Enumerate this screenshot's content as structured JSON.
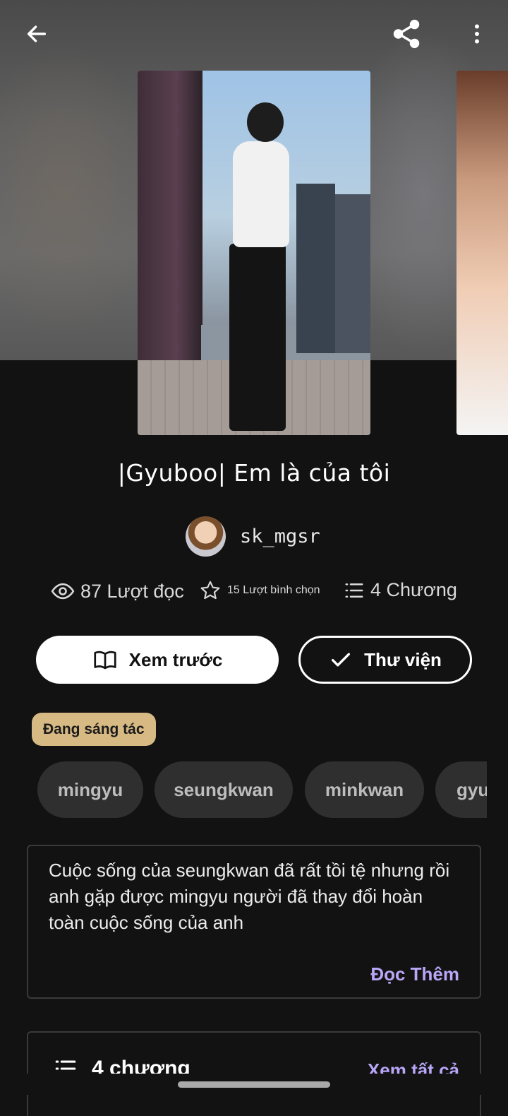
{
  "story": {
    "title": "|Gyuboo| Em là của tôi",
    "author": "sk_mgsr",
    "stats": {
      "reads": "87 Lượt đọc",
      "votes": "15 Lượt bình chọn",
      "parts": "4 Chương"
    },
    "status": "Đang sáng tác",
    "tags": [
      "mingyu",
      "seungkwan",
      "minkwan",
      "gyu"
    ],
    "description": "Cuộc sống của seungkwan đã rất tồi tệ nhưng rồi anh gặp được mingyu người đã thay đổi hoàn toàn cuộc sống của anh",
    "read_more": "Đọc Thêm"
  },
  "actions": {
    "preview_label": "Xem trước",
    "library_label": "Thư viện"
  },
  "parts_section": {
    "title": "4 chương",
    "see_all": "Xem tất cả"
  },
  "icons": {
    "back": "arrow-left-icon",
    "share": "share-icon",
    "more": "more-vertical-icon",
    "reads": "eye-icon",
    "votes": "star-icon",
    "parts": "list-icon",
    "preview": "book-open-icon",
    "library": "check-icon"
  },
  "colors": {
    "background": "#121212",
    "accent": "#b9a6f7",
    "status_badge": "#d7b983",
    "tag_bg": "#2f2f2f"
  }
}
